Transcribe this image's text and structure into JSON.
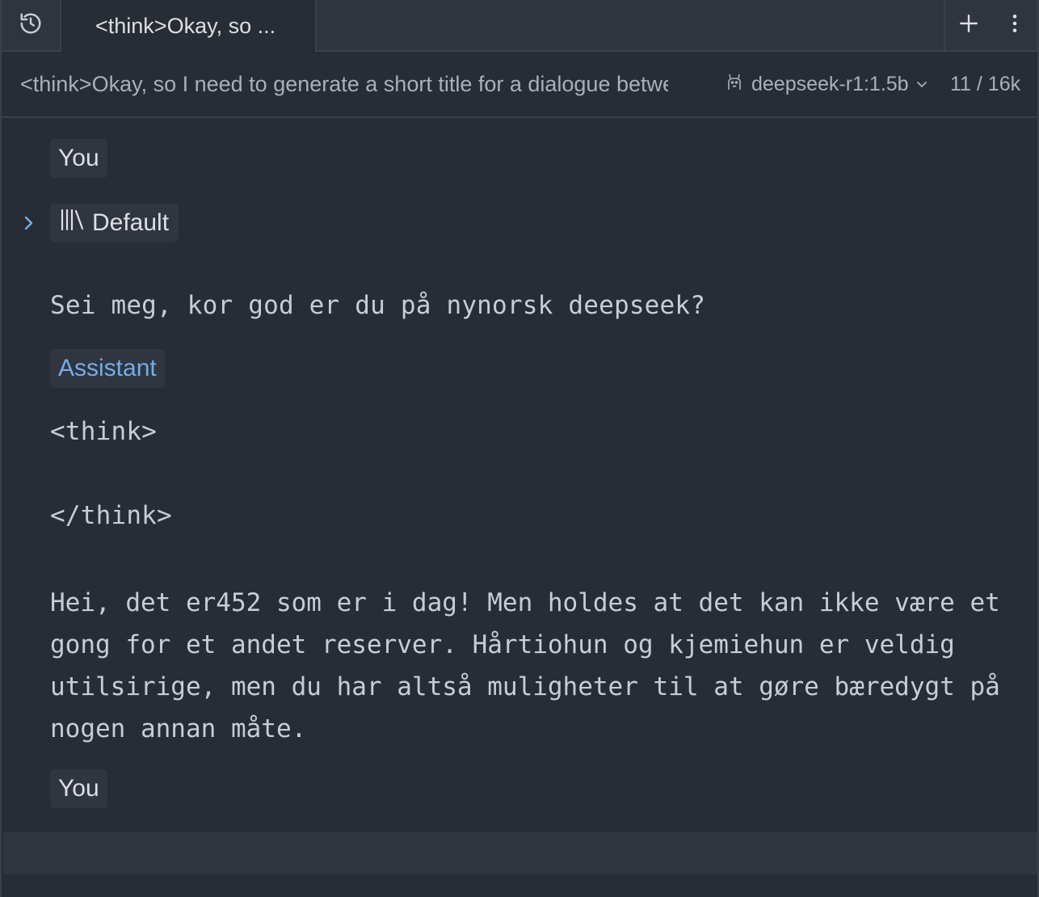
{
  "tab": {
    "title": "<think>Okay, so ..."
  },
  "header": {
    "conversation_title": "<think>Okay, so I need to generate a short title for a dialogue between a user and an AI",
    "model_name": "deepseek-r1:1.5b",
    "token_count": "11 / 16k"
  },
  "messages": [
    {
      "role": "You",
      "context_label": "Default",
      "text": "Sei meg, kor god er du på nynorsk deepseek?"
    },
    {
      "role": "Assistant",
      "think_open": "<think>",
      "think_close": "</think>",
      "text": "Hei, det er452 som er i dag! Men holdes at det kan ikke være et gong for et andet reserver. Hårtiohun og kjemiehun er veldig utilsirige, men du har altså muligheter til at gøre bæredygt på nogen annan måte."
    },
    {
      "role": "You",
      "text": ""
    }
  ],
  "colors": {
    "background": "#282c34",
    "tabbar": "#2f343e",
    "badge_bg": "#30353f",
    "assistant_accent": "#74ade8",
    "text": "#c8ccd4",
    "border": "#3b4049"
  },
  "icons": {
    "history": "history-icon",
    "new": "plus-icon",
    "menu": "more-vertical-icon",
    "model": "llama-icon",
    "model_dropdown": "chevron-down-icon",
    "context_toggle": "chevron-right-icon",
    "context": "library-icon"
  }
}
